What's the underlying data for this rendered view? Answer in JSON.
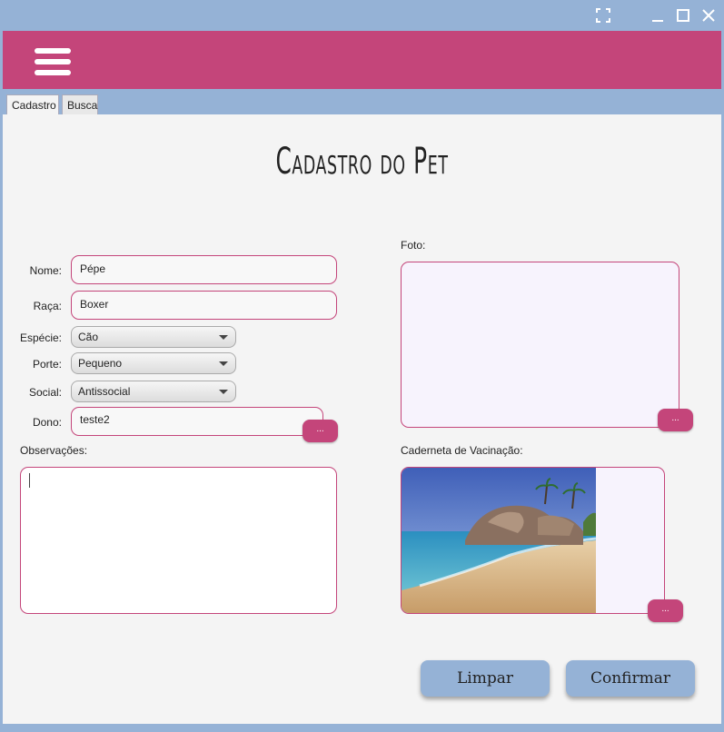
{
  "window": {
    "fullscreen_icon": "fullscreen-icon",
    "minimize_icon": "minimize-icon",
    "maximize_icon": "maximize-icon",
    "close_icon": "close-icon"
  },
  "header": {
    "menu_icon": "hamburger-menu-icon",
    "color": "#c4457a"
  },
  "tabs": [
    {
      "label": "Cadastro"
    },
    {
      "label": "Busca"
    }
  ],
  "page": {
    "title": "Cadastro do Pet"
  },
  "form": {
    "nome": {
      "label": "Nome:",
      "value": "Pépe"
    },
    "raca": {
      "label": "Raça:",
      "value": "Boxer"
    },
    "especie": {
      "label": "Espécie:",
      "value": "Cão"
    },
    "porte": {
      "label": "Porte:",
      "value": "Pequeno"
    },
    "social": {
      "label": "Social:",
      "value": "Antissocial"
    },
    "dono": {
      "label": "Dono:",
      "value": "teste2",
      "button": "..."
    },
    "observacoes": {
      "label": "Observações:",
      "value": ""
    },
    "foto": {
      "label": "Foto:",
      "button": "..."
    },
    "caderneta": {
      "label": "Caderneta de Vacinação:",
      "button": "..."
    }
  },
  "actions": {
    "limpar": "Limpar",
    "confirmar": "Confirmar"
  },
  "colors": {
    "accent": "#c4457a",
    "window_frame": "#95b2d6",
    "image_bg": "#f7f3fd"
  }
}
